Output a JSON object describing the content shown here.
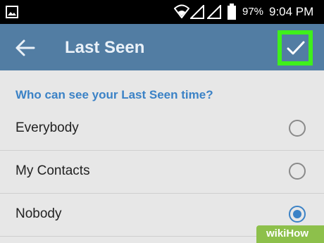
{
  "status_bar": {
    "battery": "97%",
    "time": "9:04 PM",
    "icons": [
      "image-icon",
      "wifi-icon",
      "signal-icon",
      "signal-icon",
      "battery-icon"
    ]
  },
  "app_bar": {
    "title": "Last Seen",
    "back_icon": "arrow-left-icon",
    "confirm_icon": "check-icon",
    "highlight_color": "#3ff01c",
    "background": "#527da3"
  },
  "section": {
    "header": "Who can see your Last Seen time?"
  },
  "options": [
    {
      "label": "Everybody",
      "selected": false
    },
    {
      "label": "My Contacts",
      "selected": false
    },
    {
      "label": "Nobody",
      "selected": true
    }
  ],
  "accent_color": "#3b82c6",
  "watermark": "wikiHow"
}
